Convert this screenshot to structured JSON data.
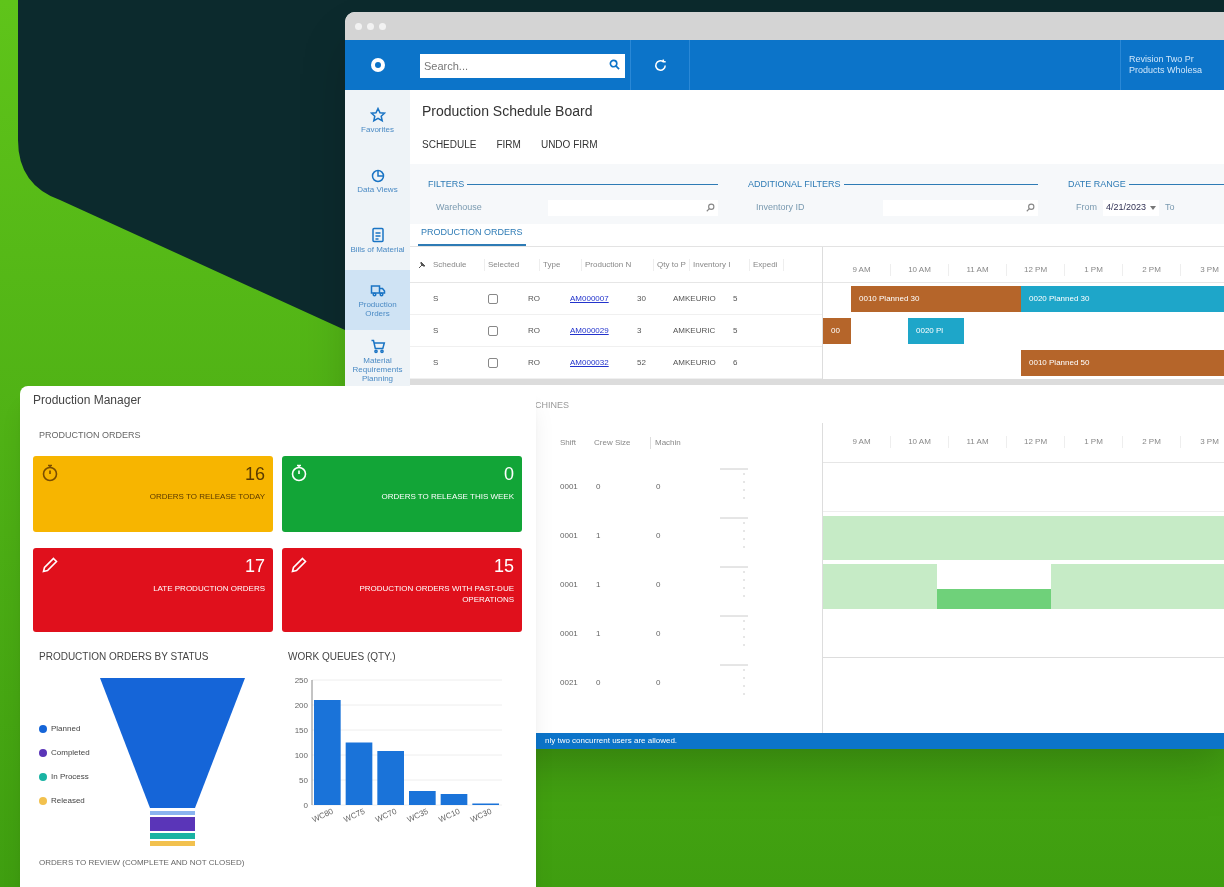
{
  "main_window": {
    "search": {
      "placeholder": "Search..."
    },
    "user": {
      "company": "Revision Two Pr",
      "branch": "Products Wholesa"
    },
    "sidebar": [
      {
        "label": "Favorites",
        "kind": "star",
        "selected": false
      },
      {
        "label": "Data Views",
        "kind": "pie",
        "selected": false
      },
      {
        "label": "Bills of Material",
        "kind": "doc",
        "selected": false
      },
      {
        "label": "Production Orders",
        "kind": "truck",
        "selected": true
      },
      {
        "label": "Material Requirements Planning",
        "kind": "cart",
        "selected": false
      }
    ],
    "title": "Production Schedule Board",
    "toolbar": [
      "SCHEDULE",
      "FIRM",
      "UNDO FIRM"
    ],
    "filters": {
      "heading": "FILTERS",
      "field_label": "Warehouse"
    },
    "additional_filters": {
      "heading": "ADDITIONAL FILTERS",
      "field_label": "Inventory ID"
    },
    "date_range": {
      "heading": "DATE RANGE",
      "from_label": "From",
      "from_value": "4/21/2023",
      "to_label": "To"
    },
    "tabs": [
      {
        "label": "PRODUCTION ORDERS",
        "selected": true
      }
    ],
    "orders_table": {
      "columns": [
        "Schedule",
        "Selected",
        "Type",
        "Production N",
        "Qty to P",
        "Inventory I",
        "Expedi"
      ],
      "rows": [
        {
          "schedule": "S",
          "checked": false,
          "type": "RO",
          "production_nbr": "AM000007",
          "qty": "30",
          "inventory": "AMKEURIO",
          "expedite": "5"
        },
        {
          "schedule": "S",
          "checked": false,
          "type": "RO",
          "production_nbr": "AM000029",
          "qty": "3",
          "inventory": "AMKEURIC",
          "expedite": "5"
        },
        {
          "schedule": "S",
          "checked": false,
          "type": "RO",
          "production_nbr": "AM000032",
          "qty": "52",
          "inventory": "AMKEURIO",
          "expedite": "6"
        }
      ]
    },
    "timeline_hours": [
      "9 AM",
      "10 AM",
      "11 AM",
      "12 PM",
      "1 PM",
      "2 PM",
      "3 PM"
    ],
    "gantt_rows": [
      [
        {
          "label": "0010 Planned 30",
          "color": "#b5652a"
        },
        {
          "label": "0020 Planned 30",
          "color": "#1ea6c9"
        }
      ],
      [
        {
          "label": "00",
          "color": "#b5652a"
        },
        {
          "label": "0020 Pl",
          "color": "#1ea6c9"
        }
      ],
      [
        {
          "label": "0010 Planned 50",
          "color": "#b5652a"
        }
      ]
    ],
    "machines_section": "CHINES",
    "machines_table": {
      "columns": [
        "Shift",
        "Crew Size",
        "Machin"
      ],
      "rows": [
        {
          "shift": "0001",
          "crew": "0",
          "machine": "0"
        },
        {
          "shift": "0001",
          "crew": "1",
          "machine": "0"
        },
        {
          "shift": "0001",
          "crew": "1",
          "machine": "0"
        },
        {
          "shift": "0001",
          "crew": "1",
          "machine": "0"
        },
        {
          "shift": "0021",
          "crew": "0",
          "machine": "0"
        }
      ]
    },
    "machine_hours": [
      "9 AM",
      "10 AM",
      "11 AM",
      "12 PM",
      "1 PM",
      "2 PM",
      "3 PM"
    ],
    "status_message": "nly two concurrent users are allowed."
  },
  "dashboard": {
    "title": "Production Manager",
    "section": "PRODUCTION ORDERS",
    "tiles": [
      {
        "value": "16",
        "label": "ORDERS TO RELEASE TODAY",
        "kind": "stopwatch",
        "color": "#f7b500"
      },
      {
        "value": "0",
        "label": "ORDERS TO RELEASE THIS WEEK",
        "kind": "stopwatch",
        "color": "#12a537"
      },
      {
        "value": "17",
        "label": "LATE PRODUCTION ORDERS",
        "kind": "pencil",
        "color": "#e0101c"
      },
      {
        "value": "15",
        "label": "PRODUCTION ORDERS WITH PAST-DUE OPERATIONS",
        "kind": "pencil",
        "color": "#e0101c"
      }
    ],
    "status_chart": {
      "title": "PRODUCTION ORDERS BY STATUS",
      "legend": [
        {
          "label": "Planned",
          "color": "#1565d8"
        },
        {
          "label": "Completed",
          "color": "#5a35b8"
        },
        {
          "label": "In Process",
          "color": "#19b3a3"
        },
        {
          "label": "Released",
          "color": "#f2c14e"
        }
      ]
    },
    "queue_chart": {
      "title": "WORK QUEUES (QTY.)",
      "chart_data": {
        "type": "bar",
        "categories": [
          "WC80",
          "WC75",
          "WC70",
          "WC35",
          "WC10",
          "WC30"
        ],
        "series": [
          {
            "color": "#1a73d9",
            "values": [
              210,
              125,
              108,
              28,
              22,
              3
            ]
          }
        ],
        "grid": true,
        "ylim": [
          0,
          250
        ],
        "yticks": [
          0,
          50,
          100,
          150,
          200,
          250
        ]
      }
    },
    "footer_section": "ORDERS TO REVIEW (COMPLETE AND NOT CLOSED)"
  }
}
